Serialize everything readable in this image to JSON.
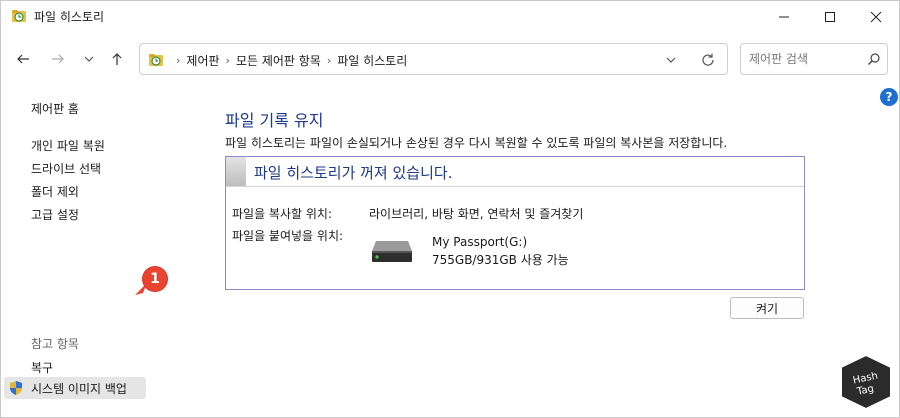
{
  "window": {
    "title": "파일 히스토리",
    "controls": {
      "minimize": "minimize-icon",
      "maximize": "maximize-icon",
      "close": "close-icon"
    }
  },
  "nav": {
    "breadcrumbs": [
      "제어판",
      "모든 제어판 항목",
      "파일 히스토리"
    ],
    "search_placeholder": "제어판 검색"
  },
  "sidebar": {
    "home": "제어판 홈",
    "links": [
      "개인 파일 복원",
      "드라이브 선택",
      "폴더 제외",
      "고급 설정"
    ],
    "see_also_heading": "참고 항목",
    "recovery": "복구",
    "system_image_backup": "시스템 이미지 백업"
  },
  "annotation": {
    "badge": "1",
    "badge_color": "#e8452f"
  },
  "main": {
    "title": "파일 기록 유지",
    "description": "파일 히스토리는 파일이 손실되거나 손상된 경우 다시 복원할 수 있도록 파일의 복사본을 저장합니다.",
    "status": "파일 히스토리가 꺼져 있습니다.",
    "copy_from_label": "파일을 복사할 위치:",
    "copy_from_value": "라이브러리, 바탕 화면, 연락처 및 즐겨찾기",
    "copy_to_label": "파일을 붙여넣을 위치:",
    "drive_name": "My Passport(G:)",
    "drive_space": "755GB/931GB 사용 가능",
    "turn_on_button": "켜기"
  },
  "watermark": {
    "line1": "Hash",
    "line2": "Tag"
  },
  "colors": {
    "accent": "#1e3a8a",
    "help": "#1e6fd1",
    "panel_border": "#8c8cc8"
  }
}
